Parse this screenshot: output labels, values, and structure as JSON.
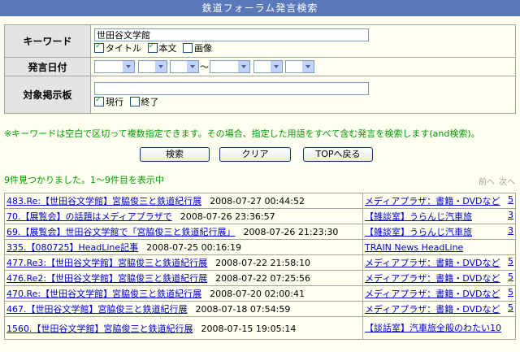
{
  "page_title": "鉄道フォーラム発言検索",
  "form": {
    "keyword_label": "キーワード",
    "keyword_value": "世田谷文学館",
    "opt_title": "タイトル",
    "opt_body": "本文",
    "opt_image": "画像",
    "date_label": "発言日付",
    "date_tilde": "～",
    "board_label": "対象掲示板",
    "board_value": "",
    "opt_current": "現行",
    "opt_ended": "終了"
  },
  "note": "※キーワードは空白で区切って複数指定できます。その場合、指定した用語をすべて含む発言を検索します(and検索)。",
  "buttons": {
    "search": "検索",
    "clear": "クリア",
    "top": "TOPへ戻る"
  },
  "found_text": "9件見つかりました。1～9件目を表示中",
  "pager": {
    "prev": "前へ",
    "next": "次へ"
  },
  "results": [
    {
      "title": "483.Re:【世田谷文学館】宮脇俊三と鉄道紀行展",
      "date": "2008-07-27 00:44:52",
      "forum": "メディアプラザ：書籍・DVDなど",
      "count": "5"
    },
    {
      "title": "70.【展覧会】の話題はメディアプラザで",
      "date": "2008-07-26 23:36:57",
      "forum": "【雑談室】うらんじ汽車旅",
      "count": "3"
    },
    {
      "title": "69.【展覧会】世田谷文学館で「宮脇俊三と鉄道紀行展」",
      "date": "2008-07-26 21:23:30",
      "forum": "【雑談室】うらんじ汽車旅",
      "count": "3"
    },
    {
      "title": "335.【080725】HeadLine記事",
      "date": "2008-07-25 00:16:19",
      "forum": "TRAIN News HeadLine",
      "count": ""
    },
    {
      "title": "477.Re3:【世田谷文学館】宮脇俊三と鉄道紀行展",
      "date": "2008-07-22 21:58:10",
      "forum": "メディアプラザ：書籍・DVDなど",
      "count": "5"
    },
    {
      "title": "476.Re2:【世田谷文学館】宮脇俊三と鉄道紀行展",
      "date": "2008-07-22 07:25:56",
      "forum": "メディアプラザ：書籍・DVDなど",
      "count": "5"
    },
    {
      "title": "470.Re:【世田谷文学館】宮脇俊三と鉄道紀行展",
      "date": "2008-07-20 02:00:41",
      "forum": "メディアプラザ：書籍・DVDなど",
      "count": "5"
    },
    {
      "title": "467.【世田谷文学館】宮脇俊三と鉄道紀行展",
      "date": "2008-07-18 07:54:59",
      "forum": "メディアプラザ：書籍・DVDなど",
      "count": "5"
    },
    {
      "title": "1560.【世田谷文学館】宮脇俊三と鉄道紀行展",
      "date": "2008-07-15 19:05:14",
      "forum": "【談話室】汽車旅全般のわたい",
      "count": "10"
    }
  ]
}
